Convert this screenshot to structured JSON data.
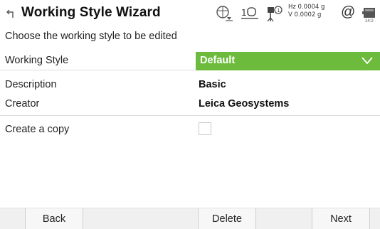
{
  "header": {
    "title": "Working Style Wizard",
    "tilt_hz": "Hz 0.0004 g",
    "tilt_v": "V  0.0002 g",
    "at_symbol": "@",
    "time": "14:2",
    "icons": [
      "back-arrow-icon",
      "gps-icon",
      "instrument-face-icon",
      "pole-icon",
      "at-icon",
      "battery-icon"
    ]
  },
  "prompt": "Choose the working style to be edited",
  "fields": {
    "working_style": {
      "label": "Working Style",
      "value": "Default"
    },
    "description": {
      "label": "Description",
      "value": "Basic"
    },
    "creator": {
      "label": "Creator",
      "value": "Leica Geosystems"
    },
    "create_copy": {
      "label": "Create a copy",
      "checked": false
    }
  },
  "buttons": {
    "back": "Back",
    "delete": "Delete",
    "next": "Next"
  },
  "colors": {
    "accent_green": "#6cbb3c"
  }
}
